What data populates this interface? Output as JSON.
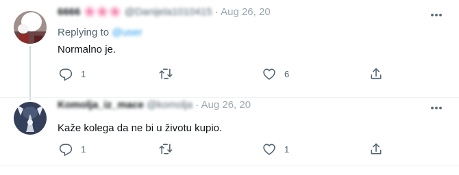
{
  "tweets": [
    {
      "display_name": "6666 🌸🌸🌸",
      "handle": "@Danijela1010415",
      "separator": "·",
      "date": "Aug 26, 20",
      "replying_label": "Replying to",
      "replying_handle": "@user",
      "text": "Normalno je.",
      "actions": {
        "replies": "1",
        "retweets": "",
        "likes": "6"
      },
      "icons": [
        "more-icon",
        "reply-icon",
        "retweet-icon",
        "like-icon",
        "share-icon"
      ]
    },
    {
      "display_name": "Komolja_iz_mace",
      "handle": "@komolja",
      "separator": "·",
      "date": "Aug 26, 20",
      "text": "Kaže kolega da ne bi u životu kupio.",
      "actions": {
        "replies": "1",
        "retweets": "",
        "likes": "1"
      },
      "icons": [
        "more-icon",
        "reply-icon",
        "retweet-icon",
        "like-icon",
        "share-icon"
      ]
    }
  ],
  "colors": {
    "text_primary": "#0f1419",
    "text_secondary": "#536471",
    "accent": "#1d9bf0",
    "divider": "#eff3f4",
    "thread_line": "#cfd9de"
  }
}
